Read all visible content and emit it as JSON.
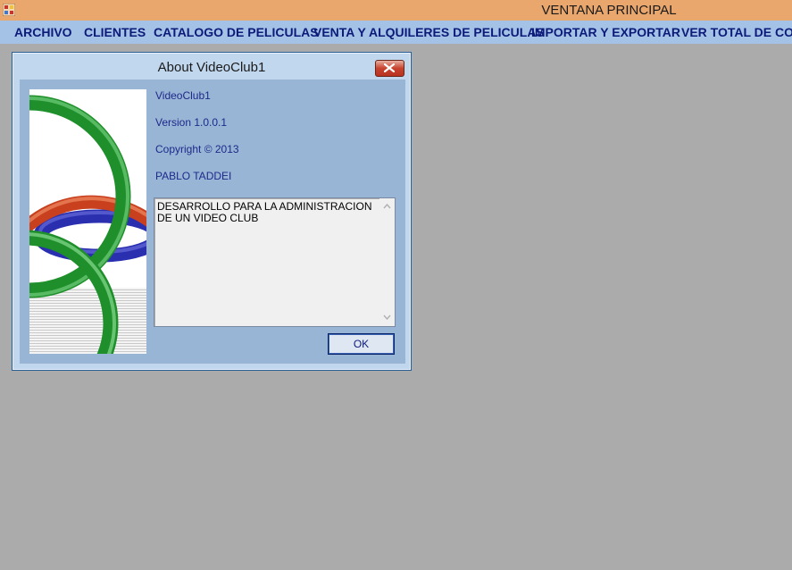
{
  "window": {
    "title": "VENTANA PRINCIPAL",
    "icon": "app-window-icon"
  },
  "menu": {
    "items": [
      {
        "label": "ARCHIVO"
      },
      {
        "label": "CLIENTES"
      },
      {
        "label": "CATALOGO DE PELICULAS"
      },
      {
        "label": "VENTA Y ALQUILERES DE PELICULAS"
      },
      {
        "label": "IMPORTAR Y EXPORTAR"
      },
      {
        "label": "VER TOTAL DE COM"
      }
    ]
  },
  "about_dialog": {
    "title": "About VideoClub1",
    "product_name": "VideoClub1",
    "version": "Version 1.0.0.1",
    "copyright": "Copyright ©  2013",
    "company": "PABLO TADDEI",
    "description": "DESARROLLO PARA LA ADMINISTRACION DE UN VIDEO CLUB",
    "ok_label": "OK",
    "close_icon": "close-icon",
    "logo": "interlocking-rings-logo"
  },
  "colors": {
    "titlebar": "#e9a76d",
    "menubar": "#a4c2e6",
    "menu_text": "#0c1a7a",
    "workspace": "#ababab",
    "dialog_body": "#99b5d6"
  }
}
